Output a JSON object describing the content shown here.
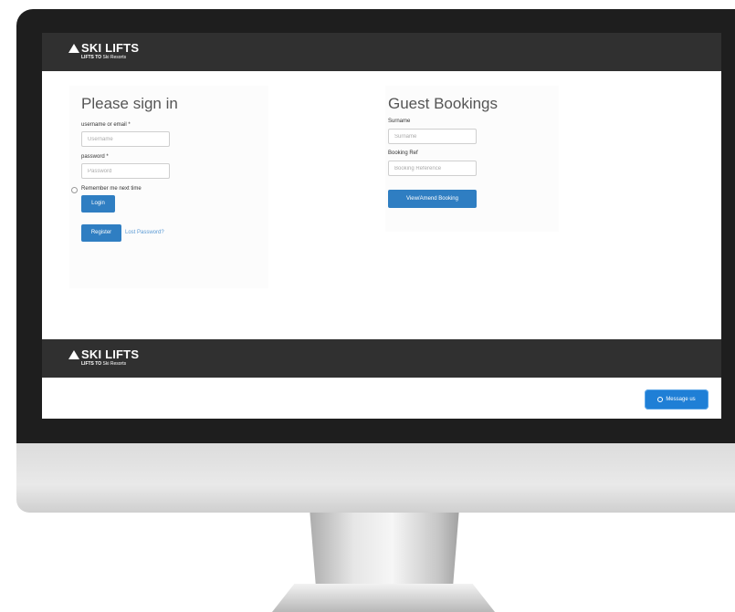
{
  "brand": {
    "name": "SKI LIFTS",
    "tagline_bold": "LIFTS TO",
    "tagline_rest": " Ski Resorts"
  },
  "signin": {
    "heading": "Please sign in",
    "username_label": "username or email *",
    "username_placeholder": "Username",
    "password_label": "password *",
    "password_placeholder": "Password",
    "remember_label": "Remember me next time",
    "login_button": "Login",
    "register_button": "Register",
    "lost_password_link": "Lost Password?"
  },
  "guest": {
    "heading": "Guest Bookings",
    "surname_label": "Surname",
    "surname_placeholder": "Surname",
    "ref_label": "Booking Ref",
    "ref_placeholder": "Booking Reference",
    "view_button": "View/Amend Booking"
  },
  "chat": {
    "button_label": "Message us"
  },
  "colors": {
    "accent": "#2f7ec2",
    "header": "#303030"
  }
}
